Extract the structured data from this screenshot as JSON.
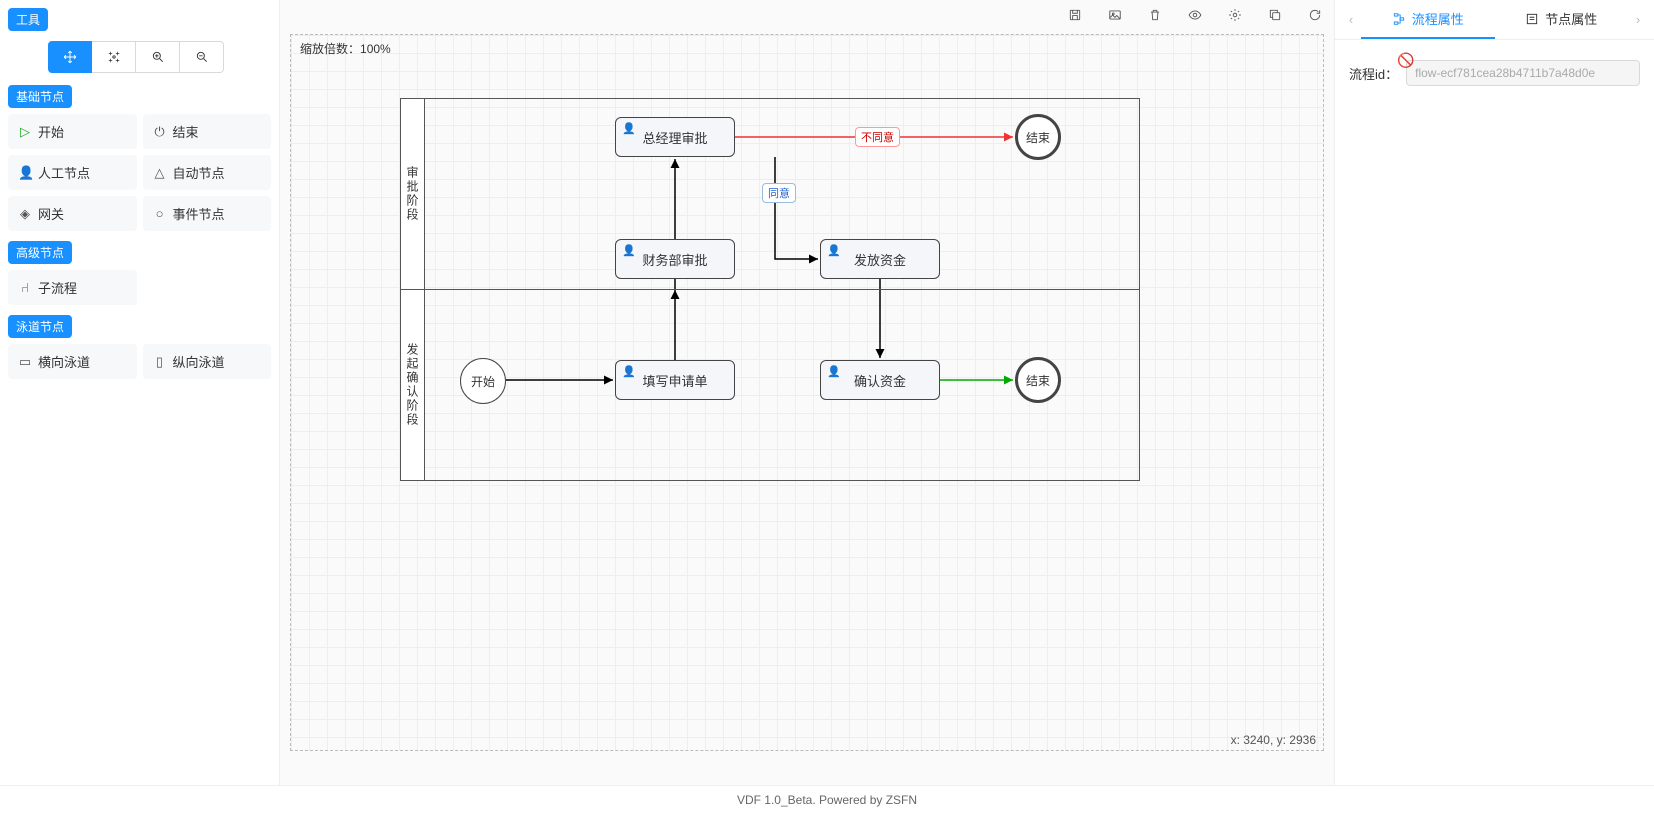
{
  "sidebar": {
    "tools_badge": "工具",
    "sections": {
      "basic": {
        "badge": "基础节点",
        "items": [
          "开始",
          "结束",
          "人工节点",
          "自动节点",
          "网关",
          "事件节点"
        ]
      },
      "advanced": {
        "badge": "高级节点",
        "items": [
          "子流程"
        ]
      },
      "lane": {
        "badge": "泳道节点",
        "items": [
          "横向泳道",
          "纵向泳道"
        ]
      }
    }
  },
  "canvas": {
    "zoom_label": "缩放倍数：",
    "zoom_value": "100%",
    "coords_label": "x: 3240, y: 2936",
    "lanes": [
      {
        "title": "审批阶段"
      },
      {
        "title": "发起确认阶段"
      }
    ],
    "nodes": {
      "start": "开始",
      "fill_form": "填写申请单",
      "finance": "财务部审批",
      "gm": "总经理审批",
      "release": "发放资金",
      "confirm": "确认资金",
      "end1": "结束",
      "end2": "结束"
    },
    "edges": {
      "disagree": "不同意",
      "agree": "同意"
    }
  },
  "right": {
    "tab_flow": "流程属性",
    "tab_node": "节点属性",
    "flow_id_label": "流程id：",
    "flow_id_value": "flow-ecf781cea28b4711b7a48d0e"
  },
  "footer": "VDF 1.0_Beta. Powered by ZSFN"
}
